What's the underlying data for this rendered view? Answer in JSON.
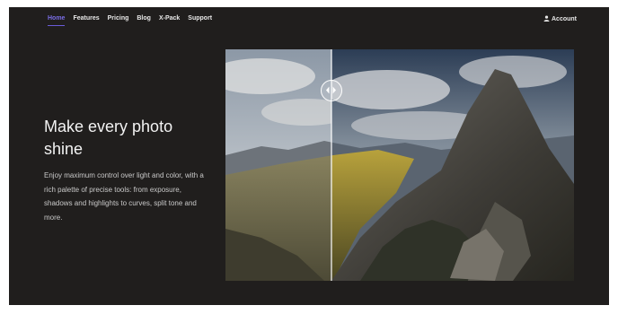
{
  "nav": {
    "items": [
      {
        "label": "Home",
        "active": true
      },
      {
        "label": "Features",
        "active": false
      },
      {
        "label": "Pricing",
        "active": false
      },
      {
        "label": "Blog",
        "active": false
      },
      {
        "label": "X-Pack",
        "active": false
      },
      {
        "label": "Support",
        "active": false
      }
    ],
    "account_label": "Account",
    "account_icon": "user-icon"
  },
  "hero": {
    "title": "Make every photo shine",
    "body": "Enjoy maximum control over light and color, with a rich palette of precise tools: from exposure, shadows and highlights to curves, split tone and more."
  },
  "comparison": {
    "split_fraction": 0.305,
    "handle_icon": "left-right-arrows-icon"
  },
  "colors": {
    "background": "#201e1d",
    "accent": "#7a6ee6",
    "text": "#f2f2f2"
  }
}
